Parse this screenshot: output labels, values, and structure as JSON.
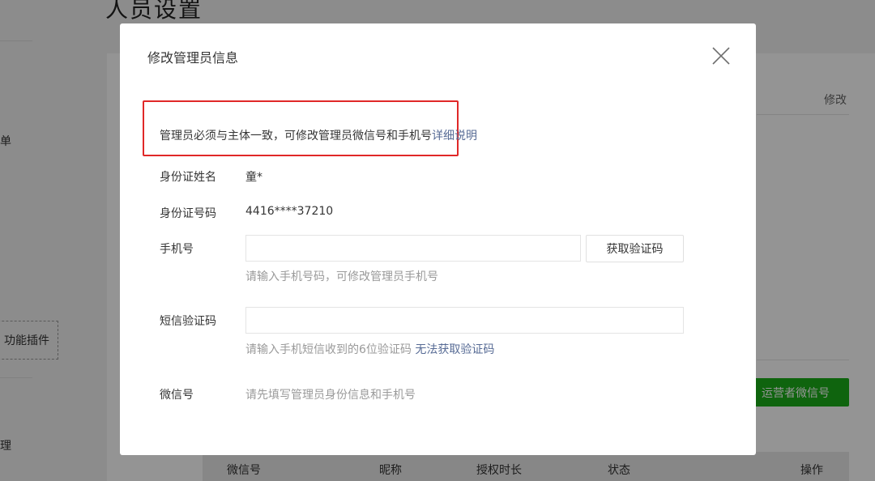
{
  "background": {
    "page_title": "人员设置",
    "sidebar": [
      "单",
      "功能插件",
      "理"
    ],
    "edit_link": "修改",
    "add_operator_button": "运营者微信号",
    "table_headers": [
      "微信号",
      "昵称",
      "授权时长",
      "状态",
      "操作"
    ]
  },
  "dialog": {
    "title": "修改管理员信息",
    "close_icon": "close-icon",
    "notice": {
      "text": "管理员必须与主体一致，可修改管理员微信号和手机号",
      "link": "详细说明"
    },
    "id_name": {
      "label": "身份证姓名",
      "value": "童*"
    },
    "id_number": {
      "label": "身份证号码",
      "value": "4416****37210"
    },
    "phone": {
      "label": "手机号",
      "value": "",
      "hint": "请输入手机号码，可修改管理员手机号",
      "button": "获取验证码"
    },
    "sms_code": {
      "label": "短信验证码",
      "value": "",
      "hint": "请输入手机短信收到的6位验证码",
      "hint_link": "无法获取验证码"
    },
    "wechat": {
      "label": "微信号",
      "hint": "请先填写管理员身份信息和手机号"
    }
  },
  "colors": {
    "link": "#576b95",
    "highlight_border": "#e02828",
    "primary_green": "#1aad19",
    "hint_text": "#9a9a9a"
  }
}
